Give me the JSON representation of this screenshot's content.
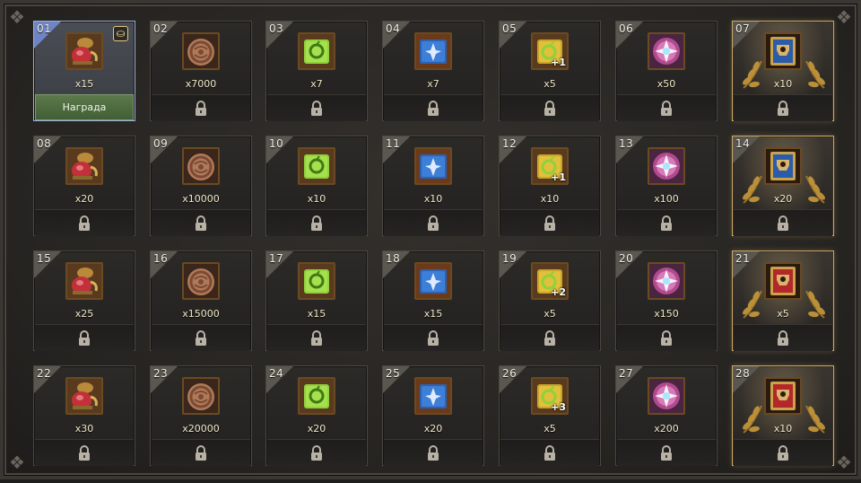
{
  "reward_button_label": "Награда",
  "cells": [
    {
      "num": "01",
      "qty": "x15",
      "item": "tea-kettle",
      "state": "claimable"
    },
    {
      "num": "02",
      "qty": "x7000",
      "item": "coin-pouch",
      "state": "locked"
    },
    {
      "num": "03",
      "qty": "x7",
      "item": "green-scroll",
      "state": "locked"
    },
    {
      "num": "04",
      "qty": "x7",
      "item": "blue-scroll",
      "state": "locked"
    },
    {
      "num": "05",
      "qty": "x5",
      "item": "gold-ring-scroll",
      "badge": "+1",
      "state": "locked"
    },
    {
      "num": "06",
      "qty": "x50",
      "item": "crystal-orb",
      "state": "locked"
    },
    {
      "num": "07",
      "qty": "x10",
      "item": "blue-card",
      "state": "locked",
      "premium": true
    },
    {
      "num": "08",
      "qty": "x20",
      "item": "tea-kettle",
      "state": "locked"
    },
    {
      "num": "09",
      "qty": "x10000",
      "item": "coin-pouch",
      "state": "locked"
    },
    {
      "num": "10",
      "qty": "x10",
      "item": "green-scroll",
      "state": "locked"
    },
    {
      "num": "11",
      "qty": "x10",
      "item": "blue-scroll",
      "state": "locked"
    },
    {
      "num": "12",
      "qty": "x10",
      "item": "gold-ring-scroll",
      "badge": "+1",
      "state": "locked"
    },
    {
      "num": "13",
      "qty": "x100",
      "item": "crystal-orb",
      "state": "locked"
    },
    {
      "num": "14",
      "qty": "x20",
      "item": "blue-card",
      "state": "locked",
      "premium": true
    },
    {
      "num": "15",
      "qty": "x25",
      "item": "tea-kettle",
      "state": "locked"
    },
    {
      "num": "16",
      "qty": "x15000",
      "item": "coin-pouch",
      "state": "locked"
    },
    {
      "num": "17",
      "qty": "x15",
      "item": "green-scroll",
      "state": "locked"
    },
    {
      "num": "18",
      "qty": "x15",
      "item": "blue-scroll",
      "state": "locked"
    },
    {
      "num": "19",
      "qty": "x5",
      "item": "gold-ring-scroll",
      "badge": "+2",
      "state": "locked"
    },
    {
      "num": "20",
      "qty": "x150",
      "item": "crystal-orb",
      "state": "locked"
    },
    {
      "num": "21",
      "qty": "x5",
      "item": "red-card",
      "state": "locked",
      "premium": true
    },
    {
      "num": "22",
      "qty": "x30",
      "item": "tea-kettle",
      "state": "locked"
    },
    {
      "num": "23",
      "qty": "x20000",
      "item": "coin-pouch",
      "state": "locked"
    },
    {
      "num": "24",
      "qty": "x20",
      "item": "green-scroll",
      "state": "locked"
    },
    {
      "num": "25",
      "qty": "x20",
      "item": "blue-scroll",
      "state": "locked"
    },
    {
      "num": "26",
      "qty": "x5",
      "item": "gold-ring-scroll",
      "badge": "+3",
      "state": "locked"
    },
    {
      "num": "27",
      "qty": "x200",
      "item": "crystal-orb",
      "state": "locked"
    },
    {
      "num": "28",
      "qty": "x10",
      "item": "red-card",
      "state": "locked",
      "premium": true
    }
  ]
}
